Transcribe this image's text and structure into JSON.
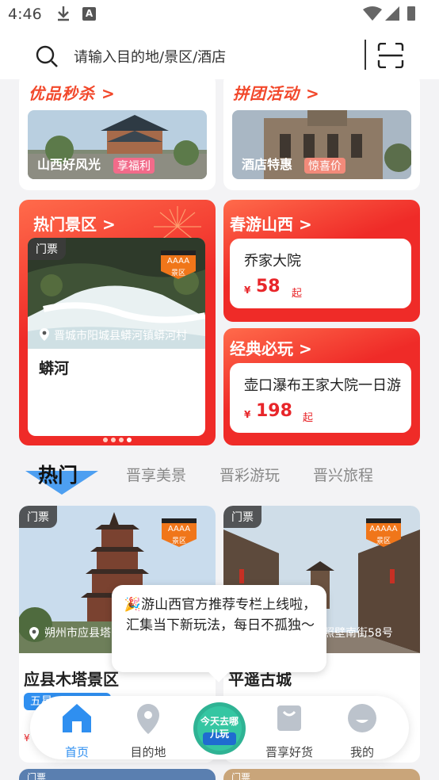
{
  "status": {
    "time": "4:46"
  },
  "search": {
    "placeholder": "请输入目的地/景区/酒店"
  },
  "promos": [
    {
      "title": "优品秒杀 >",
      "caption": "山西好风光",
      "tag": "享福利"
    },
    {
      "title": "拼团活动 >",
      "caption": "酒店特惠",
      "tag": "惊喜价"
    }
  ],
  "hot_spots": {
    "title": "热门景区 >",
    "ticket": "门票",
    "badge_top": "AAAA",
    "badge_bottom": "景区",
    "address": "晋城市阳城县蟒河镇蟒河村",
    "name": "蟒河"
  },
  "spring": {
    "title": "春游山西 >",
    "item": "乔家大院",
    "currency": "¥",
    "price": "58",
    "suffix": "起"
  },
  "classic": {
    "title": "经典必玩 >",
    "item": "壶口瀑布王家大院一日游",
    "currency": "¥",
    "price": "198",
    "suffix": "起"
  },
  "tabs": [
    "热门",
    "晋享美景",
    "晋彩游玩",
    "晋兴旅程"
  ],
  "listings": [
    {
      "ticket": "门票",
      "badge_top": "AAAA",
      "badge_bottom": "景区",
      "address": "朔州市应县塔",
      "title": "应县木塔景区",
      "tag": "五星",
      "currency": "¥"
    },
    {
      "ticket": "门票",
      "badge_top": "AAAAA",
      "badge_bottom": "景区",
      "address": "照壁南街58号",
      "title": "平遥古城"
    }
  ],
  "bubble": {
    "text": "🎉游山西官方推荐专栏上线啦，汇集当下新玩法，每日不孤独～"
  },
  "nav": {
    "home": "首页",
    "destination": "目的地",
    "center": "今天去哪儿玩",
    "goods": "晋享好货",
    "mine": "我的"
  },
  "next_row": {
    "ticket": "门票"
  }
}
